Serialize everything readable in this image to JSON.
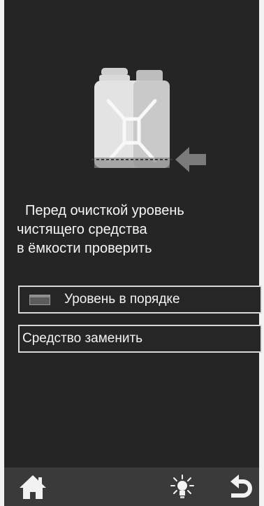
{
  "instruction": {
    "line1": "Перед очисткой уровень",
    "line2": "чистящего средства",
    "line3": "в ёмкости проверить"
  },
  "buttons": {
    "level_ok": {
      "label": "Уровень в порядке",
      "icon": "level-indicator-icon"
    },
    "replace": {
      "label": "Средство заменить"
    }
  },
  "nav": {
    "home_icon": "home-icon",
    "light_icon": "light-bulb-icon",
    "back_icon": "back-arrow-icon"
  },
  "colors": {
    "background": "#252525",
    "text": "#f5f5f5",
    "button_border": "#d9d9d9",
    "nav_bar": "#3a3a3a"
  }
}
